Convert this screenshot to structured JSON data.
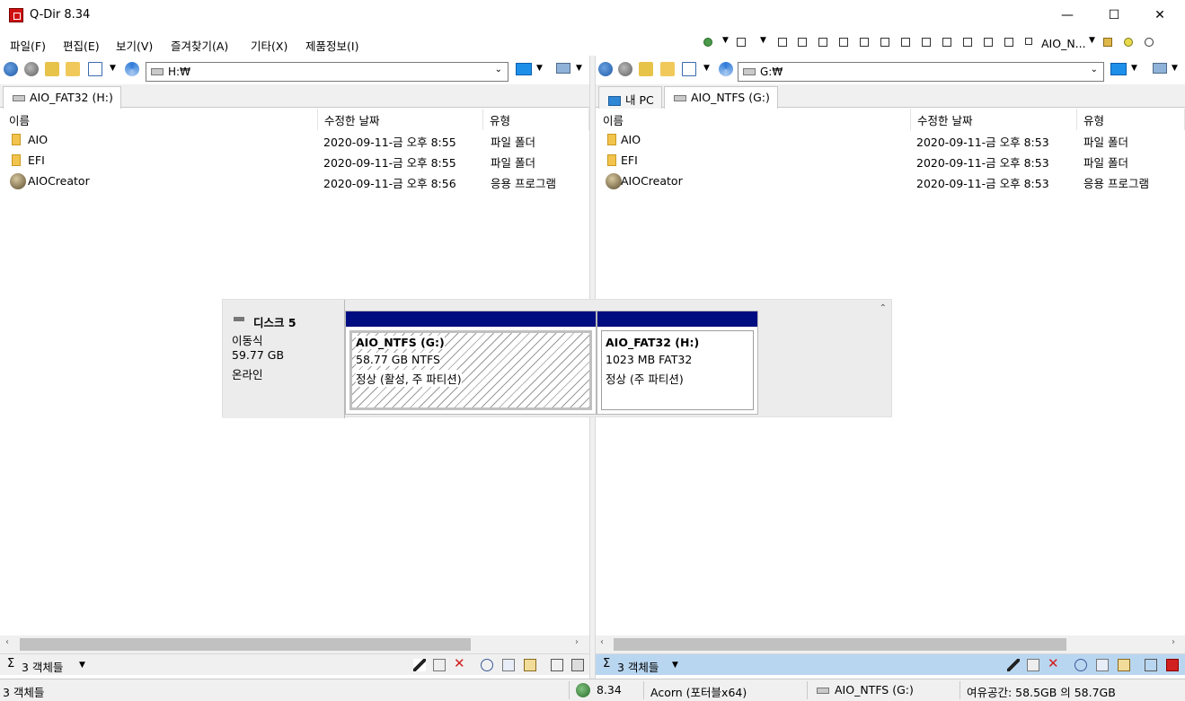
{
  "window": {
    "title": "Q-Dir 8.34",
    "minimize": "—",
    "maximize": "☐",
    "close": "✕"
  },
  "menu": [
    "파일(F)",
    "편집(E)",
    "보기(V)",
    "즐겨찾기(A)",
    "기타(X)",
    "제품정보(I)"
  ],
  "toolbar": {
    "drive_label": "AIO_N..."
  },
  "left_pane": {
    "address": "H:₩",
    "tabs": [
      {
        "label": "AIO_FAT32 (H:)",
        "icon": "drive-icon",
        "active": true
      }
    ],
    "columns": [
      "이름",
      "수정한 날짜",
      "유형"
    ],
    "rows": [
      {
        "name": "AIO",
        "date": "2020-09-11-금 오후 8:55",
        "type": "파일 폴더",
        "icon": "folder-icon"
      },
      {
        "name": "EFI",
        "date": "2020-09-11-금 오후 8:55",
        "type": "파일 폴더",
        "icon": "folder-icon"
      },
      {
        "name": "AIOCreator",
        "date": "2020-09-11-금 오후 8:56",
        "type": "응용 프로그램",
        "icon": "app-icon"
      }
    ],
    "status": {
      "sigma": "Σ",
      "count": "3 객체들"
    }
  },
  "right_pane": {
    "address": "G:₩",
    "tabs": [
      {
        "label": "내 PC",
        "icon": "pc-icon",
        "active": false
      },
      {
        "label": "AIO_NTFS (G:)",
        "icon": "drive-icon",
        "active": true
      }
    ],
    "columns": [
      "이름",
      "수정한 날짜",
      "유형"
    ],
    "rows": [
      {
        "name": "AIO",
        "date": "2020-09-11-금 오후 8:53",
        "type": "파일 폴더",
        "icon": "folder-icon"
      },
      {
        "name": "EFI",
        "date": "2020-09-11-금 오후 8:53",
        "type": "파일 폴더",
        "icon": "folder-icon"
      },
      {
        "name": "AIOCreator",
        "date": "2020-09-11-금 오후 8:53",
        "type": "응용 프로그램",
        "icon": "app-icon"
      }
    ],
    "status": {
      "sigma": "Σ",
      "count": "3 객체들"
    }
  },
  "disk_panel": {
    "name": "디스크 5",
    "type": "이동식",
    "size": "59.77 GB",
    "state": "온라인",
    "partitions": [
      {
        "label": "AIO_NTFS  (G:)",
        "size": "58.77 GB NTFS",
        "status": "정상 (활성, 주 파티션)",
        "selected": true
      },
      {
        "label": "AIO_FAT32  (H:)",
        "size": "1023 MB FAT32",
        "status": "정상 (주 파티션)",
        "selected": false
      }
    ],
    "header_color": "#000d80"
  },
  "bottom_status": {
    "count": "3 객체들",
    "version": "8.34",
    "edition": "Acorn (포터블x64)",
    "drive": "AIO_NTFS (G:)",
    "free_space": "여유공간: 58.5GB 의 58.7GB"
  }
}
